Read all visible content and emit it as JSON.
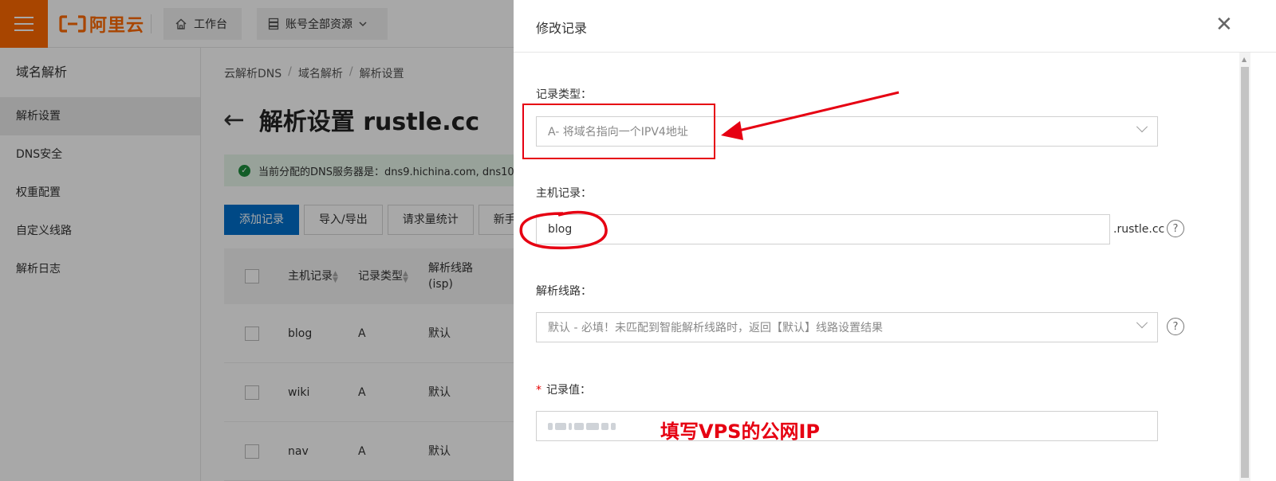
{
  "topbar": {
    "logo_text": "阿里云",
    "workbench_label": "工作台",
    "resources_label": "账号全部资源"
  },
  "sidebar": {
    "title": "域名解析",
    "items": [
      {
        "label": "解析设置",
        "active": true
      },
      {
        "label": "DNS安全"
      },
      {
        "label": "权重配置"
      },
      {
        "label": "自定义线路"
      },
      {
        "label": "解析日志"
      }
    ]
  },
  "breadcrumb": [
    "云解析DNS",
    "域名解析",
    "解析设置"
  ],
  "page": {
    "title": "解析设置 rustle.cc",
    "notice": "当前分配的DNS服务器是：dns9.hichina.com, dns10"
  },
  "toolbar": {
    "add_record": "添加记录",
    "import_export": "导入/导出",
    "request_stats": "请求量统计",
    "newbie": "新手"
  },
  "table": {
    "headers": {
      "host": "主机记录",
      "type": "记录类型",
      "line": "解析线路(isp)"
    },
    "rows": [
      {
        "host": "blog",
        "type": "A",
        "line": "默认"
      },
      {
        "host": "wiki",
        "type": "A",
        "line": "默认"
      },
      {
        "host": "nav",
        "type": "A",
        "line": "默认"
      }
    ]
  },
  "drawer": {
    "title": "修改记录",
    "record_type_label": "记录类型：",
    "record_type_value": "A- 将域名指向一个IPV4地址",
    "host_label": "主机记录：",
    "host_value": "blog",
    "host_suffix": ".rustle.cc",
    "line_label": "解析线路：",
    "line_value": "默认 - 必填！未匹配到智能解析线路时，返回【默认】线路设置结果",
    "value_label": "记录值：",
    "required_mark": "*",
    "help_glyph": "?"
  },
  "annotations": {
    "value_hint": "填写VPS的公网IP",
    "color": "#e60012"
  },
  "colors": {
    "brand": "#ff6a00",
    "primary": "#0070cc",
    "success": "#1e8e3e"
  }
}
